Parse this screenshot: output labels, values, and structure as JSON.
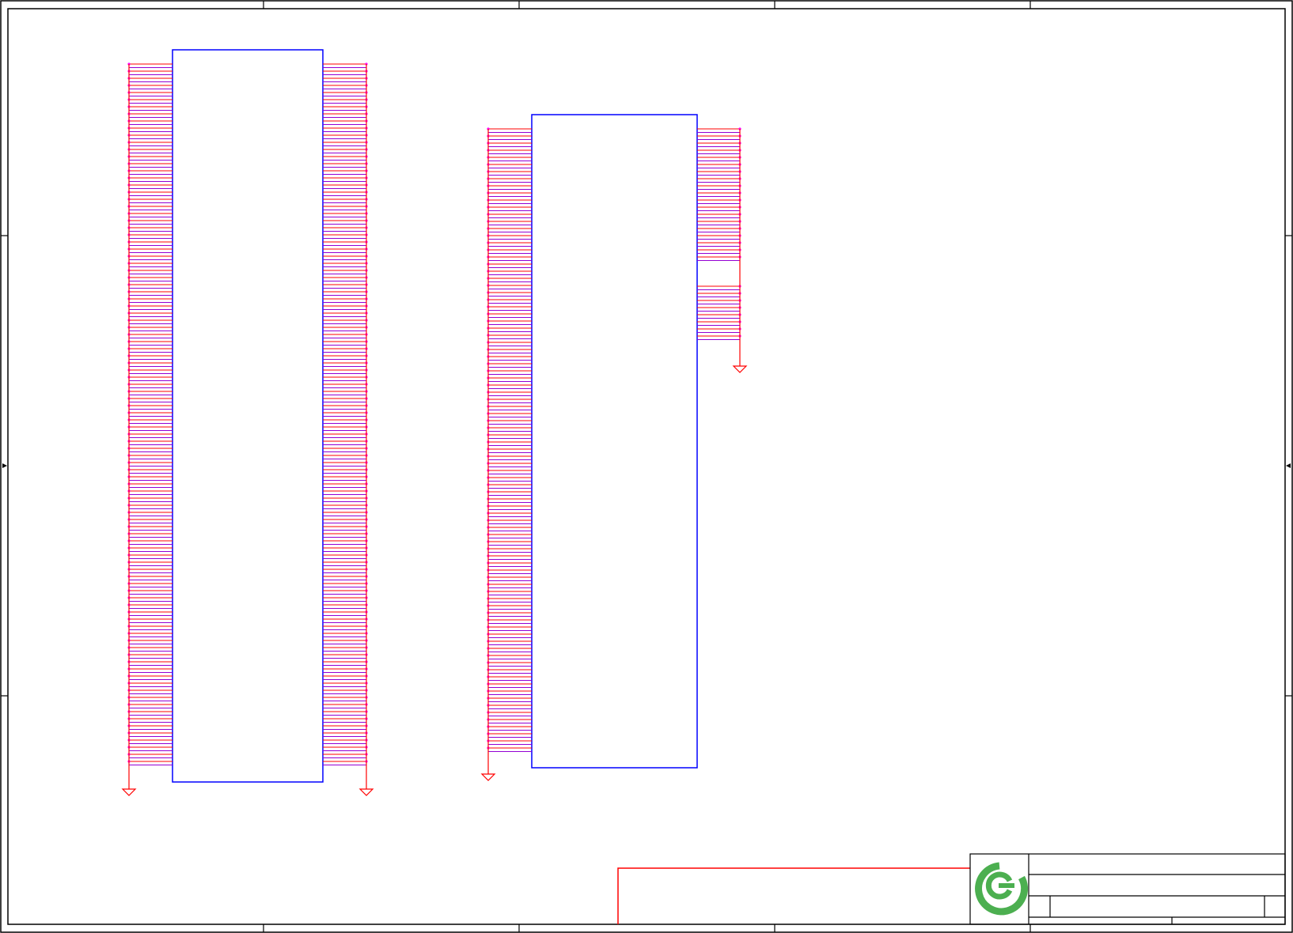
{
  "colors": {
    "frame": "#000000",
    "component_body": "#0000ff",
    "pin": "#ff0000",
    "wire": "#9400d3",
    "junction": "#ff00ff",
    "ground": "#ff0000",
    "logo": "#4caf50"
  },
  "icons": {
    "logo": "company-logo-icon",
    "ground": "ground-symbol-icon"
  },
  "sheet": {
    "border_zones": {
      "columns": 5,
      "rows": 4
    }
  },
  "components": [
    {
      "ref": "component-u1",
      "left_pins": 99,
      "right_pins": 99
    },
    {
      "ref": "component-u2",
      "left_pins": 88,
      "right_pins_upper": 19,
      "right_pins_lower": 8
    }
  ],
  "grounds": 4
}
